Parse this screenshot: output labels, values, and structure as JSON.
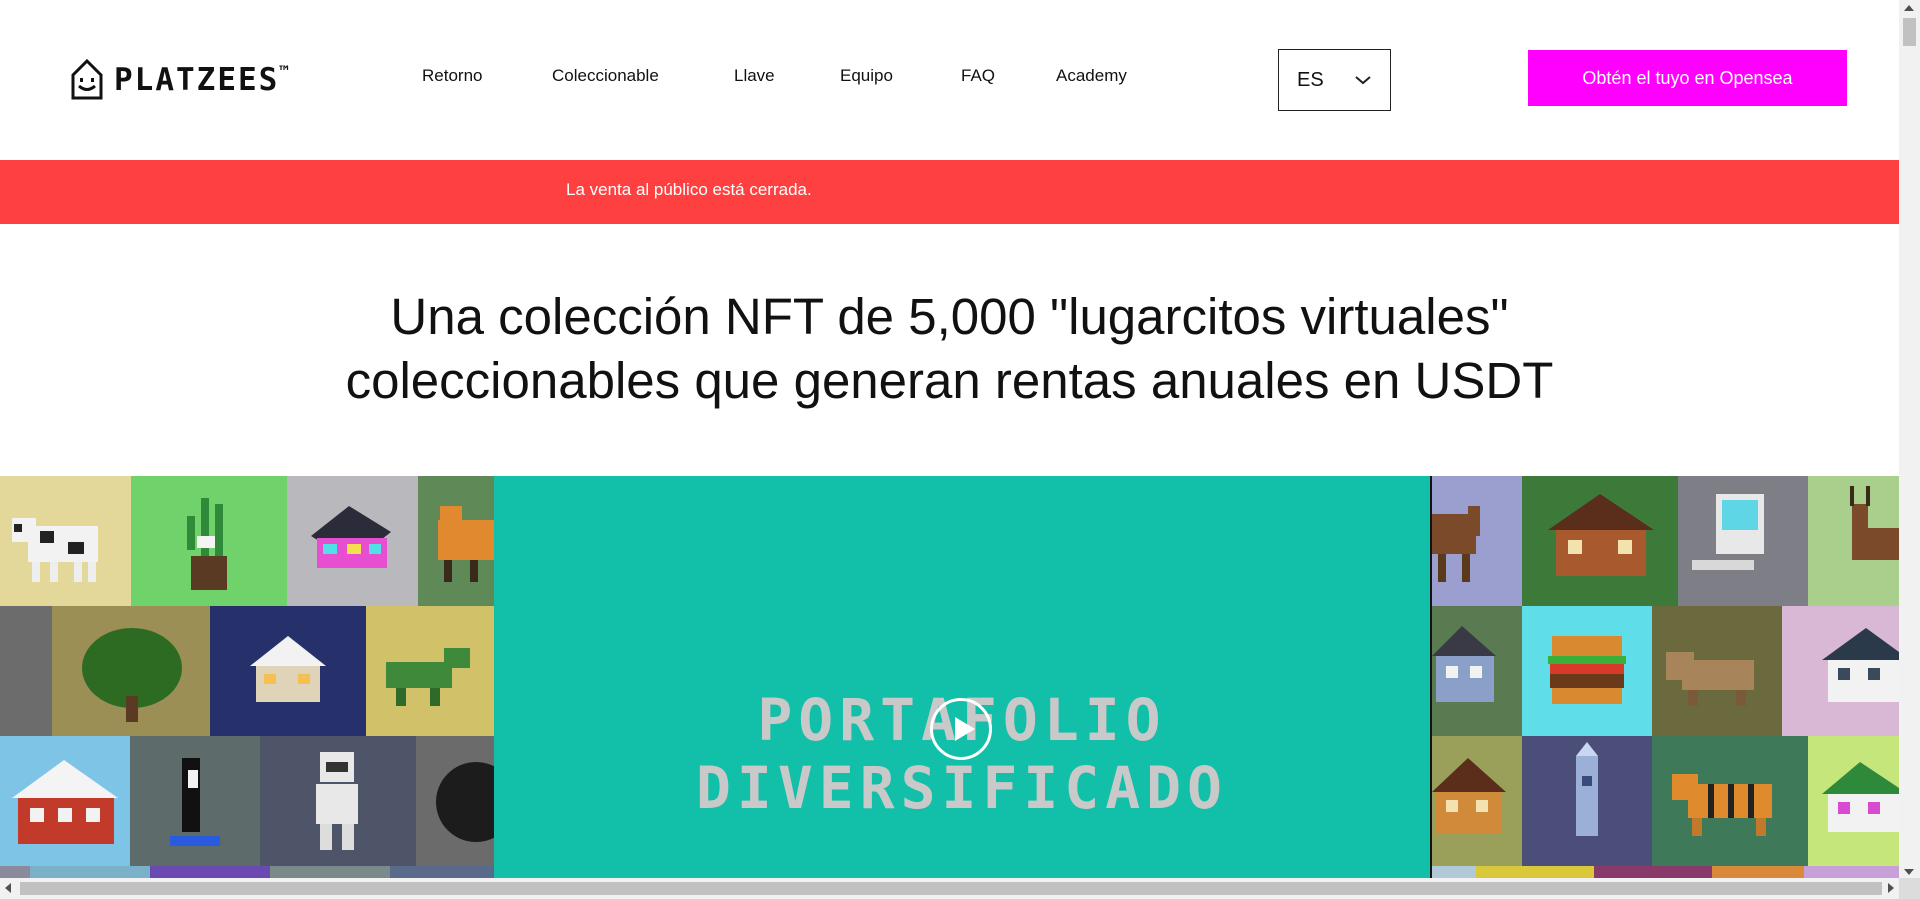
{
  "header": {
    "logo_text": "PLATZEES",
    "logo_tm": "™",
    "nav": [
      {
        "label": "Retorno"
      },
      {
        "label": "Coleccionable"
      },
      {
        "label": "Llave"
      },
      {
        "label": "Equipo"
      },
      {
        "label": "FAQ"
      },
      {
        "label": "Academy"
      }
    ],
    "language": {
      "selected": "ES"
    },
    "cta_label": "Obtén el tuyo en Opensea"
  },
  "banner": {
    "text": "La venta al público está cerrada."
  },
  "hero": {
    "title_line1": "Una colección NFT de 5,000 \"lugarcitos virtuales\"",
    "title_line2": "coleccionables que generan rentas anuales en USDT"
  },
  "gallery": {
    "video": {
      "title_line1": "PORTAFOLIO",
      "title_line2": "DIVERSIFICADO"
    },
    "left_tiles": [
      {
        "name": "cow"
      },
      {
        "name": "potted-plant"
      },
      {
        "name": "neon-house"
      },
      {
        "name": "fox"
      },
      {
        "name": "tree"
      },
      {
        "name": "snow-house"
      },
      {
        "name": "dinosaur"
      },
      {
        "name": "winter-house"
      },
      {
        "name": "orca"
      },
      {
        "name": "robot"
      },
      {
        "name": "gorilla"
      }
    ],
    "right_tiles": [
      {
        "name": "horse"
      },
      {
        "name": "wooden-cabin"
      },
      {
        "name": "computer"
      },
      {
        "name": "deer"
      },
      {
        "name": "blue-house"
      },
      {
        "name": "burger"
      },
      {
        "name": "triceratops"
      },
      {
        "name": "dark-house"
      },
      {
        "name": "brick-house"
      },
      {
        "name": "rocket"
      },
      {
        "name": "tiger"
      },
      {
        "name": "green-house"
      }
    ]
  },
  "colors": {
    "accent": "#ff00ff",
    "banner": "#ff4040",
    "video_bg": "#12bfa9"
  }
}
